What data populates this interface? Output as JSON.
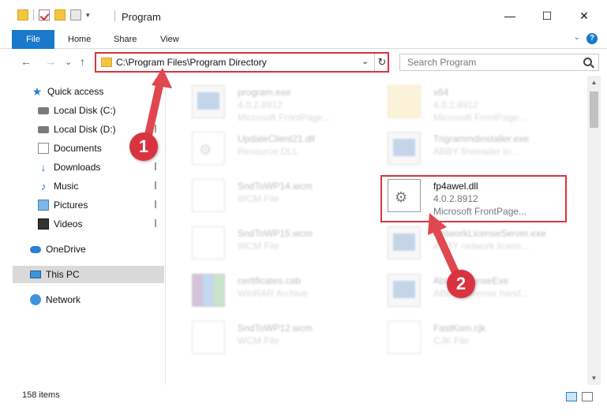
{
  "window": {
    "title": "Program",
    "controls": {
      "minimize": "—",
      "maximize": "☐",
      "close": "✕"
    }
  },
  "ribbon": {
    "tabs": [
      "File",
      "Home",
      "Share",
      "View"
    ],
    "help": "?"
  },
  "nav": {
    "back": "←",
    "forward": "→",
    "recent": "⌄",
    "up": "↑",
    "address": "C:\\Program Files\\Program Directory",
    "search_placeholder": "Search Program"
  },
  "sidebar": {
    "items": [
      {
        "label": "Quick access",
        "icon": "star-icon"
      },
      {
        "label": "Local Disk (C:)",
        "icon": "disk-icon"
      },
      {
        "label": "Local Disk (D:)",
        "icon": "disk-icon"
      },
      {
        "label": "Documents",
        "icon": "documents-icon"
      },
      {
        "label": "Downloads",
        "icon": "downloads-icon"
      },
      {
        "label": "Music",
        "icon": "music-icon"
      },
      {
        "label": "Pictures",
        "icon": "pictures-icon"
      },
      {
        "label": "Videos",
        "icon": "videos-icon"
      },
      {
        "label": "OneDrive",
        "icon": "cloud-icon"
      },
      {
        "label": "This PC",
        "icon": "computer-icon",
        "selected": true
      },
      {
        "label": "Network",
        "icon": "network-icon"
      }
    ]
  },
  "files": [
    {
      "name": "program.exe",
      "line2": "4.0.2.8912",
      "line3": "Microsoft FrontPage..."
    },
    {
      "name": "x64",
      "line2": "4.0.2.8912",
      "line3": "Microsoft FrontPage..."
    },
    {
      "name": "UpdateClient21.dll",
      "line2": "Resource DLL",
      "line3": ""
    },
    {
      "name": "Trigrammdinstaller.exe",
      "line2": "ABBY fineeader to...",
      "line3": ""
    },
    {
      "name": "SndToWP14.wcm",
      "line2": "WCM File",
      "line3": ""
    },
    {
      "name": "fp4awel.dll",
      "line2": "4.0.2.8912",
      "line3": "Microsoft FrontPage...",
      "highlighted": true
    },
    {
      "name": "SndToWP15.wcm",
      "line2": "WCM File",
      "line3": ""
    },
    {
      "name": "NetworkLicenseServer.exe",
      "line2": "ABBY network licens...",
      "line3": ""
    },
    {
      "name": "certificates.cab",
      "line2": "WinRAR Archive",
      "line3": ""
    },
    {
      "name": "AbbyyLicenseExe",
      "line2": "ABBYY license hand...",
      "line3": ""
    },
    {
      "name": "SndToWP12.wcm",
      "line2": "WCM File",
      "line3": ""
    },
    {
      "name": "FastKom.cjk",
      "line2": "CJK File",
      "line3": ""
    }
  ],
  "status": {
    "item_count": "158 items"
  },
  "annotations": {
    "step1": "1",
    "step2": "2",
    "color": "#d9333f"
  }
}
